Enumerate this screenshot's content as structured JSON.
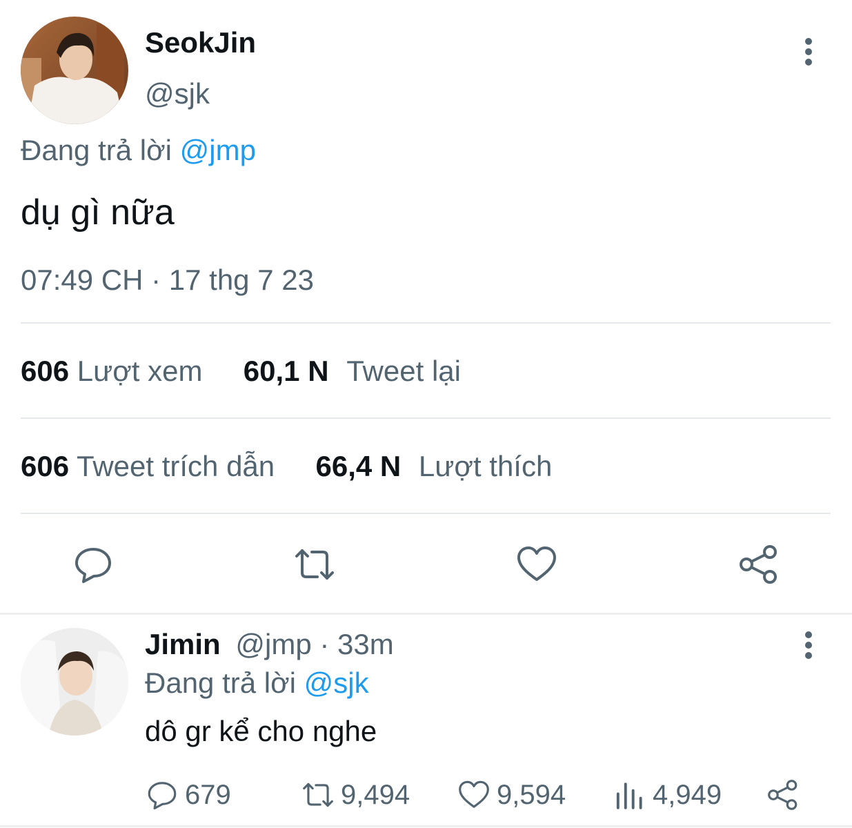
{
  "main_tweet": {
    "author_name": "SeokJin",
    "author_handle": "@sjk",
    "replying_prefix": "Đang trả lời",
    "replying_to": "@jmp",
    "text": "dụ gì nữa",
    "timestamp": "07:49 CH · 17 thg 7 23",
    "stats_row1": [
      {
        "value": "606",
        "label": "Lượt xem"
      },
      {
        "value": "60,1 N",
        "label": "Tweet lại"
      }
    ],
    "stats_row2": [
      {
        "value": "606",
        "label": "Tweet trích dẫn"
      },
      {
        "value": "66,4 N",
        "label": "Lượt thích"
      }
    ],
    "actions": [
      "reply-icon",
      "retweet-icon",
      "heart-icon",
      "share-icon"
    ]
  },
  "reply_tweet": {
    "author_name": "Jimin",
    "author_handle": "@jmp",
    "separator": "·",
    "age": "33m",
    "replying_prefix": "Đang trả lời",
    "replying_to": "@sjk",
    "text": "dô gr kể cho nghe",
    "counts": {
      "replies": "679",
      "retweets": "9,494",
      "likes": "9,594",
      "views": "4,949"
    }
  },
  "colors": {
    "text": "#0f1419",
    "muted": "#536471",
    "accent": "#1d9bf0",
    "divider": "#e6e9eb"
  }
}
